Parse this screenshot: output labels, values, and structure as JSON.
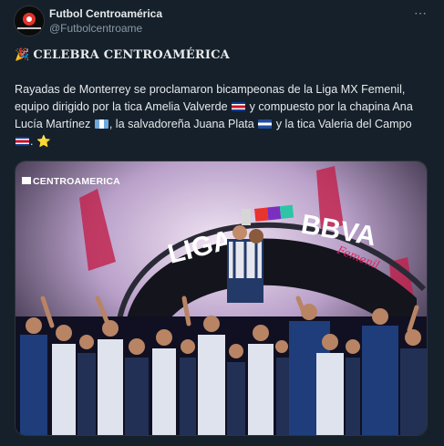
{
  "account": {
    "name": "Futbol Centroamérica",
    "handle": "@Futbolcentroame"
  },
  "more_icon": "⋯",
  "headline": {
    "emoji": "🎉",
    "text": "CELEBRA CENTROAMÉRICA"
  },
  "body": {
    "part1": "Rayadas de Monterrey se proclamaron bicampeonas de la Liga MX Femenil, equipo dirigido por la tica Amelia Valverde",
    "part2": " y compuesto por la chapina Ana Lucía Martínez",
    "part3": ", la salvadoreña Juana Plata",
    "part4": " y la tica Valeria del Campo",
    "part5": ".",
    "star": "⭐"
  },
  "media": {
    "watermark": "CENTROAMERICA",
    "banner_text": "LIGA",
    "banner_brand": "BBVA",
    "banner_sub": "Femenil"
  },
  "colors": {
    "background": "#15202b",
    "text": "#e7e9ea",
    "secondary": "#8b98a5"
  }
}
